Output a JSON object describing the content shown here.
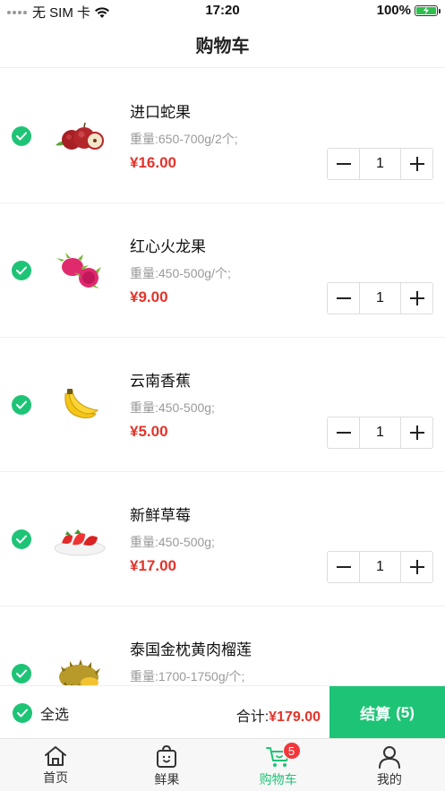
{
  "status_bar": {
    "carrier": "无 SIM 卡",
    "time": "17:20",
    "battery": "100%"
  },
  "nav": {
    "title": "购物车"
  },
  "cart": {
    "items": [
      {
        "name": "进口蛇果",
        "spec": "重量:650-700g/2个;",
        "price": "¥16.00",
        "qty": "1",
        "icon": "apple-icon"
      },
      {
        "name": "红心火龙果",
        "spec": "重量:450-500g/个;",
        "price": "¥9.00",
        "qty": "1",
        "icon": "dragonfruit-icon"
      },
      {
        "name": "云南香蕉",
        "spec": "重量:450-500g;",
        "price": "¥5.00",
        "qty": "1",
        "icon": "banana-icon"
      },
      {
        "name": "新鲜草莓",
        "spec": "重量:450-500g;",
        "price": "¥17.00",
        "qty": "1",
        "icon": "strawberry-icon"
      },
      {
        "name": "泰国金枕黄肉榴莲",
        "spec": "重量:1700-1750g/个;",
        "price": "",
        "qty": "",
        "icon": "durian-icon"
      }
    ]
  },
  "footer": {
    "select_all": "全选",
    "total_label": "合计:",
    "total_amount": "¥179.00",
    "checkout": "结算",
    "checkout_count": "(5)"
  },
  "tabs": [
    {
      "label": "首页",
      "icon": "home-icon"
    },
    {
      "label": "鲜果",
      "icon": "fruit-bag-icon"
    },
    {
      "label": "购物车",
      "icon": "cart-icon",
      "badge": "5",
      "active": true
    },
    {
      "label": "我的",
      "icon": "profile-icon"
    }
  ],
  "colors": {
    "accent": "#1ec476",
    "price": "#e3332a",
    "badge": "#f2373c"
  }
}
